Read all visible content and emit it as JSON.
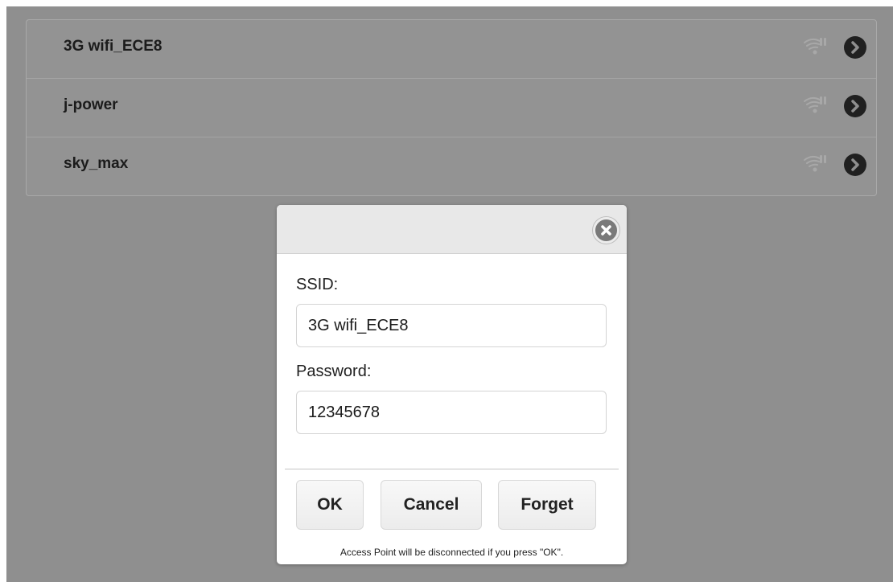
{
  "networks": [
    {
      "ssid": "3G wifi_ECE8",
      "signal_icon": "wifi-signal-icon",
      "action_icon": "chevron-right-icon"
    },
    {
      "ssid": "j-power",
      "signal_icon": "wifi-signal-icon",
      "action_icon": "chevron-right-icon"
    },
    {
      "ssid": "sky_max",
      "signal_icon": "wifi-signal-icon",
      "action_icon": "chevron-right-icon"
    }
  ],
  "dialog": {
    "close_icon": "close-icon",
    "ssid_label": "SSID:",
    "ssid_value": "3G wifi_ECE8",
    "password_label": "Password:",
    "password_value": "12345678",
    "ok_label": "OK",
    "cancel_label": "Cancel",
    "forget_label": "Forget",
    "note": "Access Point will be disconnected if you press \"OK\"."
  },
  "colors": {
    "overlay": "#8f8f8f",
    "dialog_bg": "#ffffff",
    "header_bg": "#e8e8e8"
  }
}
